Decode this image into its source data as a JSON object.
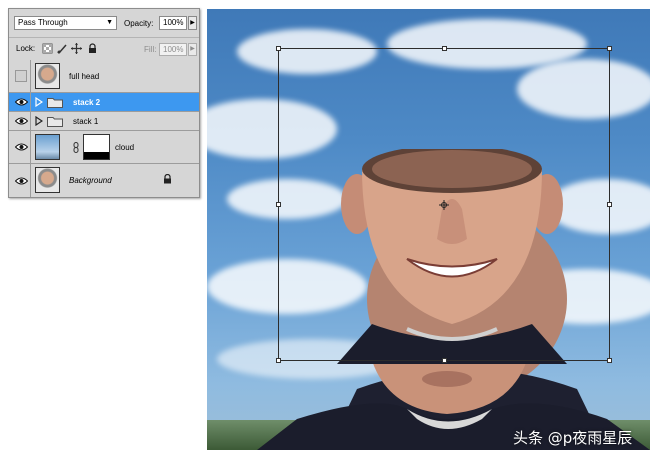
{
  "layers_panel": {
    "blend_mode": "Pass Through",
    "opacity_label": "Opacity:",
    "opacity_value": "100%",
    "lock_label": "Lock:",
    "fill_label": "Fill:",
    "fill_value": "100%",
    "layers": [
      {
        "name": "full head",
        "visible": false,
        "type": "layer",
        "thumbnail": "face"
      },
      {
        "name": "stack 2",
        "visible": true,
        "type": "group",
        "selected": true
      },
      {
        "name": "stack 1",
        "visible": true,
        "type": "group"
      },
      {
        "name": "cloud",
        "visible": true,
        "type": "layer",
        "thumbnail": "sky",
        "has_mask": true
      },
      {
        "name": "Background",
        "visible": true,
        "type": "layer",
        "thumbnail": "face",
        "locked": true
      }
    ]
  },
  "canvas": {
    "watermark": "头条 @p夜雨星辰"
  },
  "colors": {
    "selection": "#3d98f0",
    "panel_bg": "#d6d6d6",
    "sky": "#4e8ac6"
  }
}
